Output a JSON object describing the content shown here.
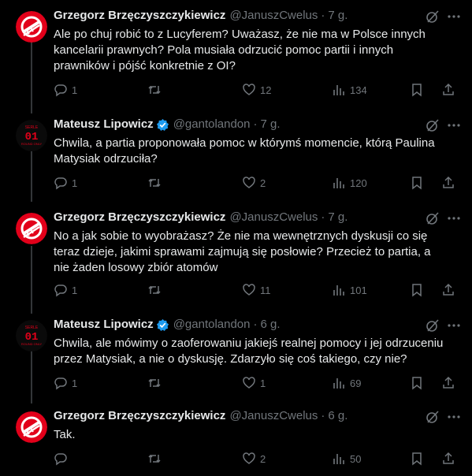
{
  "colors": {
    "background": "#000000",
    "text": "#e7e9ea",
    "muted": "#71767b",
    "thread_line": "#333639",
    "avatar_red": "#e2001a",
    "verified_blue": "#1d9bf0"
  },
  "tweets": [
    {
      "author": "Grzegorz Brzęczyszczykiewicz",
      "handle": "@JanuszCwelus",
      "separator": "·",
      "time": "7 g.",
      "verified": false,
      "text": "Ale po chuj robić to z Lucyferem? Uważasz, że nie ma w Polsce innych kancelarii prawnych? Pola musiała odrzucić pomoc partii i innych prawników i pójść konkretnie z OI?",
      "replies": "1",
      "retweets": "",
      "likes": "12",
      "views": "134",
      "avatar": "red-logo"
    },
    {
      "author": "Mateusz Lipowicz",
      "handle": "@gantolandon",
      "separator": "·",
      "time": "7 g.",
      "verified": true,
      "text": "Chwila, a partia proponowała pomoc w którymś momencie, którą Paulina Matysiak odrzuciła?",
      "replies": "1",
      "retweets": "",
      "likes": "2",
      "views": "120",
      "avatar": "dark-logo",
      "avatar_text_top": "SERLE",
      "avatar_text_mid": "01",
      "avatar_text_bot": "ROUND ONLY"
    },
    {
      "author": "Grzegorz Brzęczyszczykiewicz",
      "handle": "@JanuszCwelus",
      "separator": "·",
      "time": "7 g.",
      "verified": false,
      "text": "No a jak sobie to wyobrażasz? Że nie ma wewnętrznych dyskusji co się teraz dzieje, jakimi sprawami zajmują się posłowie? Przecież to partia, a nie żaden losowy zbiór atomów",
      "replies": "1",
      "retweets": "",
      "likes": "11",
      "views": "101",
      "avatar": "red-logo"
    },
    {
      "author": "Mateusz Lipowicz",
      "handle": "@gantolandon",
      "separator": "·",
      "time": "6 g.",
      "verified": true,
      "text": "Chwila, ale mówimy o zaoferowaniu jakiejś realnej pomocy i jej odrzuceniu przez Matysiak, a nie o dyskusję. Zdarzyło się coś takiego, czy nie?",
      "replies": "1",
      "retweets": "",
      "likes": "1",
      "views": "69",
      "avatar": "dark-logo",
      "avatar_text_top": "SERLE",
      "avatar_text_mid": "01",
      "avatar_text_bot": "ROUND ONLY"
    },
    {
      "author": "Grzegorz Brzęczyszczykiewicz",
      "handle": "@JanuszCwelus",
      "separator": "·",
      "time": "6 g.",
      "verified": false,
      "text": "Tak.",
      "replies": "",
      "retweets": "",
      "likes": "2",
      "views": "50",
      "avatar": "red-logo"
    }
  ]
}
